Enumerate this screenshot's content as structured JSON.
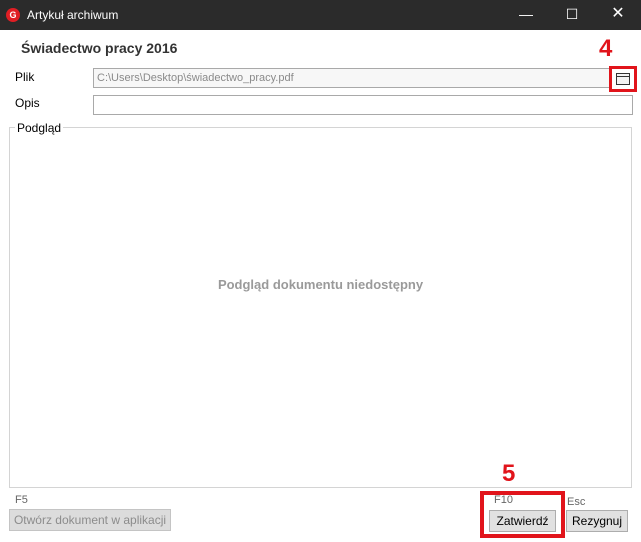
{
  "window": {
    "app_icon_letter": "G",
    "title": "Artykuł archiwum",
    "minimize": "—",
    "maximize": "☐",
    "close": "✕"
  },
  "heading": "Świadectwo pracy 2016",
  "form": {
    "file_label": "Plik",
    "file_value": "C:\\Users\\Desktop\\świadectwo_pracy.pdf",
    "description_label": "Opis",
    "description_value": ""
  },
  "annotations": {
    "step_4": "4",
    "step_5": "5"
  },
  "preview": {
    "legend": "Podgląd",
    "empty_text": "Podgląd dokumentu niedostępny"
  },
  "footer": {
    "open_key": "F5",
    "open_label": "Otwórz dokument w aplikacji",
    "confirm_key": "F10",
    "confirm_label": "Zatwierdź",
    "cancel_key": "Esc",
    "cancel_label": "Rezygnuj"
  },
  "colors": {
    "highlight": "#e1141b",
    "titlebar": "#2b2b2b",
    "app_icon": "#e01e24"
  }
}
